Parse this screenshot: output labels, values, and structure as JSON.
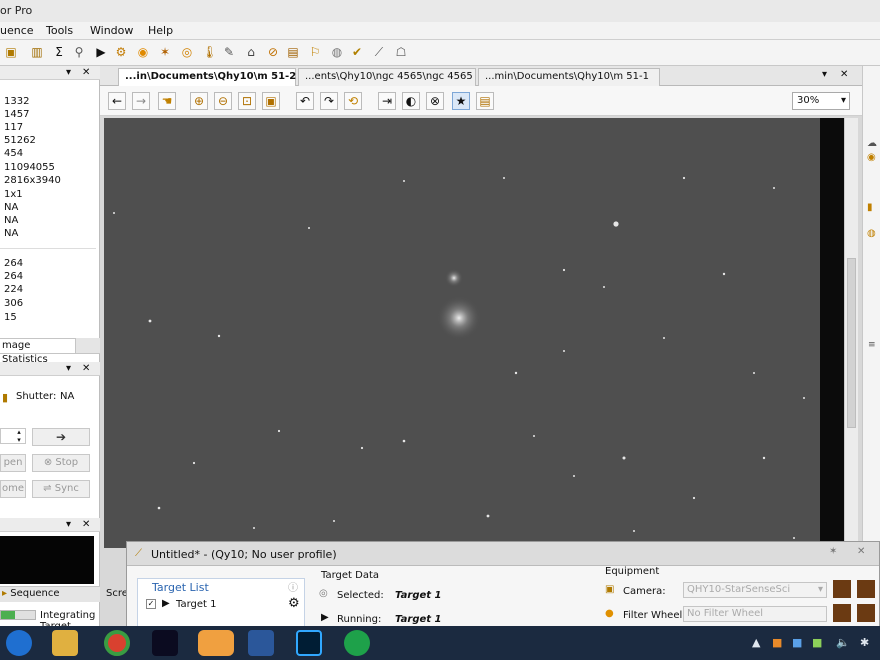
{
  "app": {
    "title": "or Pro"
  },
  "menu": [
    "uence",
    "Tools",
    "Window",
    "Help"
  ],
  "left_panel": {
    "stats_a": [
      "1332",
      "1457",
      "117",
      "51262",
      "454",
      "11094055",
      "2816x3940",
      "1x1",
      "NA",
      "NA",
      "NA"
    ],
    "stats_b": [
      "264",
      "264",
      "224",
      "306",
      "15"
    ],
    "tab_label": "mage Statistics",
    "shutter_label": "Shutter:",
    "shutter_value": "NA",
    "open_label": "pen",
    "stop_label": "Stop",
    "home_label": "ome",
    "sync_label": "Sync",
    "sequence_tab": "Sequence",
    "status": "Integrating Target"
  },
  "doc_tabs": [
    {
      "label": "...in\\Documents\\Qhy10\\m 51-2"
    },
    {
      "label": "...ents\\Qhy10\\ngc 4565\\ngc 4565"
    },
    {
      "label": "...min\\Documents\\Qhy10\\m 51-1"
    }
  ],
  "image_toolbar": {
    "zoom": "30%"
  },
  "dialog": {
    "title": "Untitled* - (Qy10; No user profile)",
    "target_list_label": "Target List",
    "target_item": "Target 1",
    "target_data_label": "Target Data",
    "selected_label": "Selected:",
    "selected_value": "Target 1",
    "running_label": "Running:",
    "running_value": "Target 1",
    "equipment_label": "Equipment",
    "camera_label": "Camera:",
    "camera_value": "QHY10-StarSenseSci",
    "filter_wheel_label": "Filter Wheel:",
    "filter_wheel_value": "No Filter Wheel",
    "scr_label": "Scre"
  },
  "colors": {
    "canvas": "#4f4f4f",
    "taskbar": "#1b2a40"
  }
}
